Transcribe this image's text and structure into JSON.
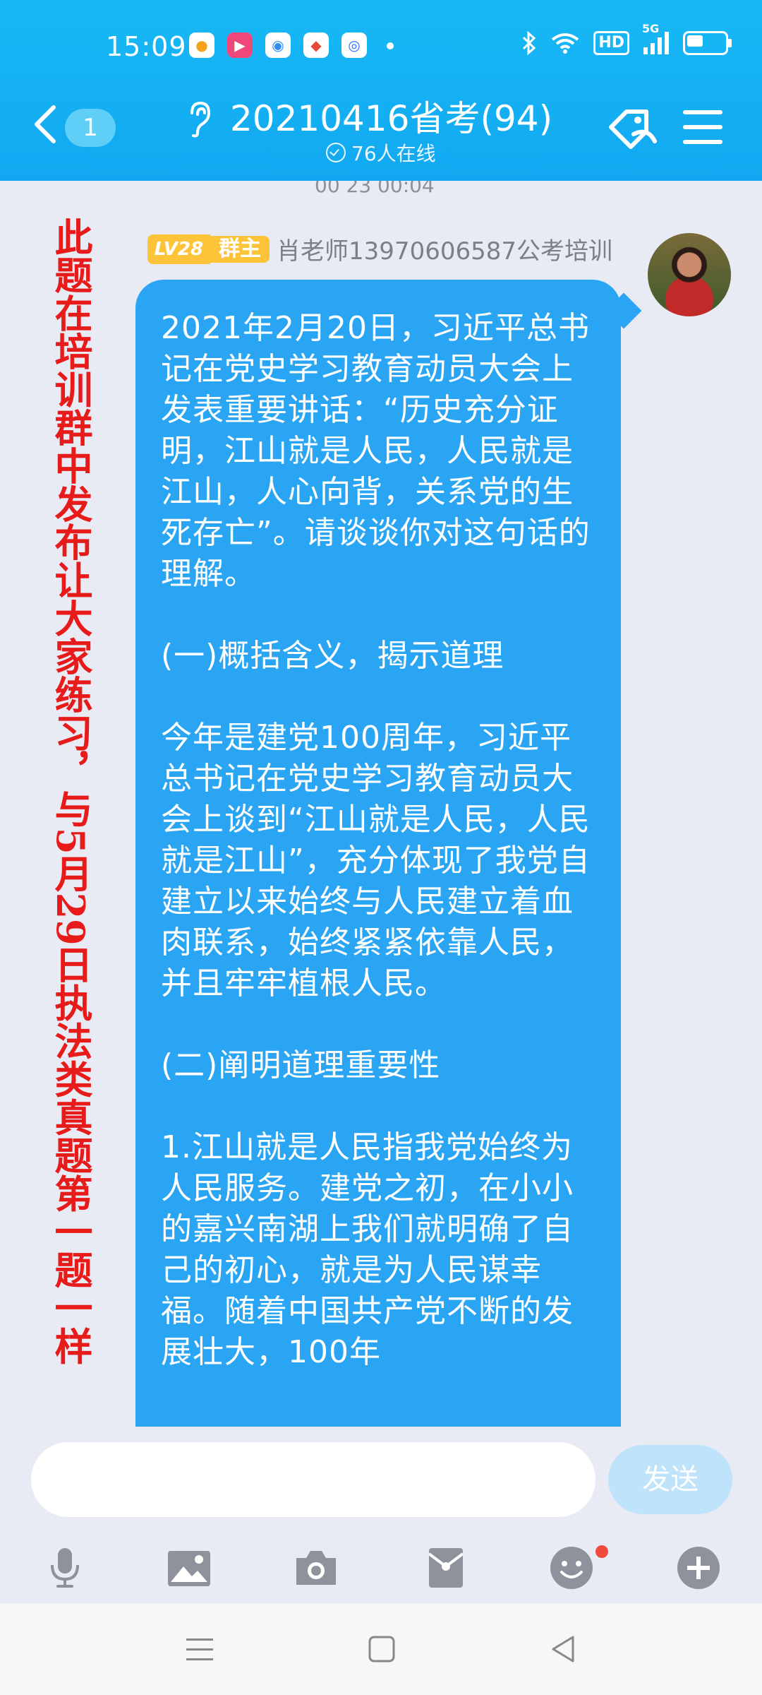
{
  "status_bar": {
    "time": "15:09",
    "network": "5G",
    "hd": "HD",
    "notification_icons": [
      "weather-app-icon",
      "video-app-icon",
      "chat-app-icon",
      "map-app-icon",
      "browser-app-icon"
    ]
  },
  "header": {
    "unread_count": "1",
    "title": "20210416省考(94)",
    "online": "76人在线"
  },
  "chat": {
    "timestamp_partial": "00 23 00:04",
    "annotation": "此题在培训群中发布让大家练习，与5月29日执法类真题第一题一样",
    "message": {
      "level": "LV28",
      "role": "群主",
      "sender": "肖老师13970606587公考培训",
      "paragraphs": [
        "2021年2月20日，习近平总书记在党史学习教育动员大会上发表重要讲话：“历史充分证明，江山就是人民，人民就是江山，人心向背，关系党的生死存亡”。请谈谈你对这句话的理解。",
        "(一)概括含义，揭示道理",
        "今年是建党100周年，习近平总书记在党史学习教育动员大会上谈到“江山就是人民，人民就是江山”，充分体现了我党自建立以来始终与人民建立着血肉联系，始终紧紧依靠人民，并且牢牢植根人民。",
        "(二)阐明道理重要性",
        "1.江山就是人民指我党始终为人民服务。建党之初，在小小的嘉兴南湖上我们就明确了自己的初心，就是为人民谋幸福。随着中国共产党不断的发展壮大，100年"
      ]
    }
  },
  "input": {
    "value": "",
    "send_label": "发送"
  },
  "colors": {
    "header": "#12a8f1",
    "bubble": "#2aa5f3",
    "annotation": "#e81b1b",
    "badge": "#fdc43a"
  }
}
